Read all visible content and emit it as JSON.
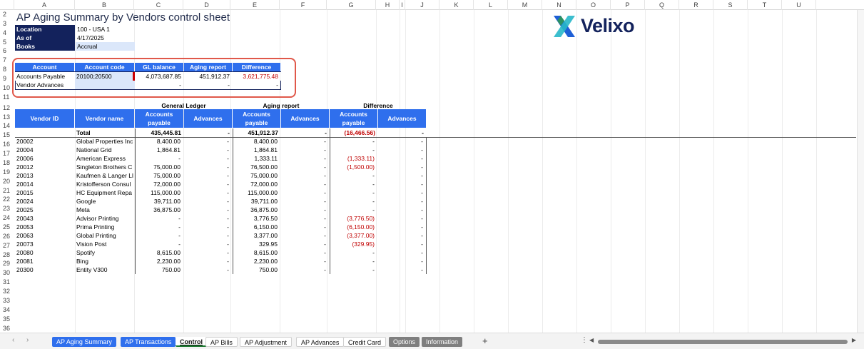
{
  "columns": [
    "A",
    "B",
    "C",
    "D",
    "E",
    "F",
    "G",
    "H",
    "I",
    "J",
    "K",
    "L",
    "M",
    "N",
    "O",
    "P",
    "Q",
    "R",
    "S",
    "T",
    "U"
  ],
  "rows": [
    "2",
    "3",
    "4",
    "5",
    "6",
    "7",
    "8",
    "9",
    "10",
    "11",
    "12",
    "13",
    "14",
    "15",
    "16",
    "17",
    "18",
    "19",
    "20",
    "21",
    "22",
    "23",
    "24",
    "25",
    "26",
    "27",
    "28",
    "29",
    "30",
    "31",
    "32",
    "33",
    "34",
    "35",
    "36"
  ],
  "title": "AP Aging Summary by Vendors control sheet",
  "logo_text": "Velixo",
  "info": [
    {
      "label": "Location",
      "value": "100 - USA 1"
    },
    {
      "label": "As of",
      "value": "4/17/2025"
    },
    {
      "label": "Books",
      "value": "Accrual"
    }
  ],
  "summary": {
    "headers": [
      "Account",
      "Account code",
      "GL balance",
      "Aging report",
      "Difference"
    ],
    "rows": [
      [
        "Accounts Payable",
        "20100;20500",
        "4,073,687.85",
        "451,912.37",
        "3,621,775.48"
      ],
      [
        "Vendor Advances",
        "",
        "-",
        "-",
        "-"
      ]
    ]
  },
  "groups": [
    "General Ledger",
    "Aging report",
    "Difference"
  ],
  "main_headers": [
    "Vendor ID",
    "Vendor name",
    "Accounts payable",
    "Advances",
    "Accounts payable",
    "Advances",
    "Accounts payable",
    "Advances"
  ],
  "total": [
    "",
    "Total",
    "435,445.81",
    "-",
    "451,912.37",
    "-",
    "(16,466.56)",
    "-"
  ],
  "data": [
    [
      "20002",
      "Global Properties Inc",
      "8,400.00",
      "-",
      "8,400.00",
      "-",
      "-",
      "-"
    ],
    [
      "20004",
      "National Grid",
      "1,864.81",
      "-",
      "1,864.81",
      "-",
      "-",
      "-"
    ],
    [
      "20006",
      "American Express",
      "-",
      "-",
      "1,333.11",
      "-",
      "(1,333.11)",
      "-"
    ],
    [
      "20012",
      "Singleton Brothers C",
      "75,000.00",
      "-",
      "76,500.00",
      "-",
      "(1,500.00)",
      "-"
    ],
    [
      "20013",
      "Kaufmen & Langer Ll",
      "75,000.00",
      "-",
      "75,000.00",
      "-",
      "-",
      "-"
    ],
    [
      "20014",
      "Kristofferson Consul",
      "72,000.00",
      "-",
      "72,000.00",
      "-",
      "-",
      "-"
    ],
    [
      "20015",
      "HC Equipment Repa",
      "115,000.00",
      "-",
      "115,000.00",
      "-",
      "-",
      "-"
    ],
    [
      "20024",
      "Google",
      "39,711.00",
      "-",
      "39,711.00",
      "-",
      "-",
      "-"
    ],
    [
      "20025",
      "Meta",
      "36,875.00",
      "-",
      "36,875.00",
      "-",
      "-",
      "-"
    ],
    [
      "20043",
      "Advisor Printing",
      "-",
      "-",
      "3,776.50",
      "-",
      "(3,776.50)",
      "-"
    ],
    [
      "20053",
      "Prima Printing",
      "-",
      "-",
      "6,150.00",
      "-",
      "(6,150.00)",
      "-"
    ],
    [
      "20063",
      "Global Printing",
      "-",
      "-",
      "3,377.00",
      "-",
      "(3,377.00)",
      "-"
    ],
    [
      "20073",
      "Vision Post",
      "-",
      "-",
      "329.95",
      "-",
      "(329.95)",
      "-"
    ],
    [
      "20080",
      "Spotify",
      "8,615.00",
      "-",
      "8,615.00",
      "-",
      "-",
      "-"
    ],
    [
      "20081",
      "Bing",
      "2,230.00",
      "-",
      "2,230.00",
      "-",
      "-",
      "-"
    ],
    [
      "20300",
      "Entity V300",
      "750.00",
      "-",
      "750.00",
      "-",
      "-",
      "-"
    ]
  ],
  "tabs": [
    {
      "label": "AP Aging Summary",
      "style": "bl"
    },
    {
      "label": "AP Transactions",
      "style": "bl"
    },
    {
      "label": "Control",
      "style": "active"
    },
    {
      "label": "AP Bills",
      "style": "wh"
    },
    {
      "label": "AP Adjustment",
      "style": "wh"
    },
    {
      "label": "AP Advances",
      "style": "wh"
    },
    {
      "label": "Credit Card",
      "style": "wh"
    },
    {
      "label": "Options",
      "style": "gr"
    },
    {
      "label": "Information",
      "style": "gr"
    }
  ],
  "colors": {
    "accent": "#2f6fed",
    "navy": "#13225c",
    "negative": "#c00000",
    "highlight": "#e0584a"
  }
}
